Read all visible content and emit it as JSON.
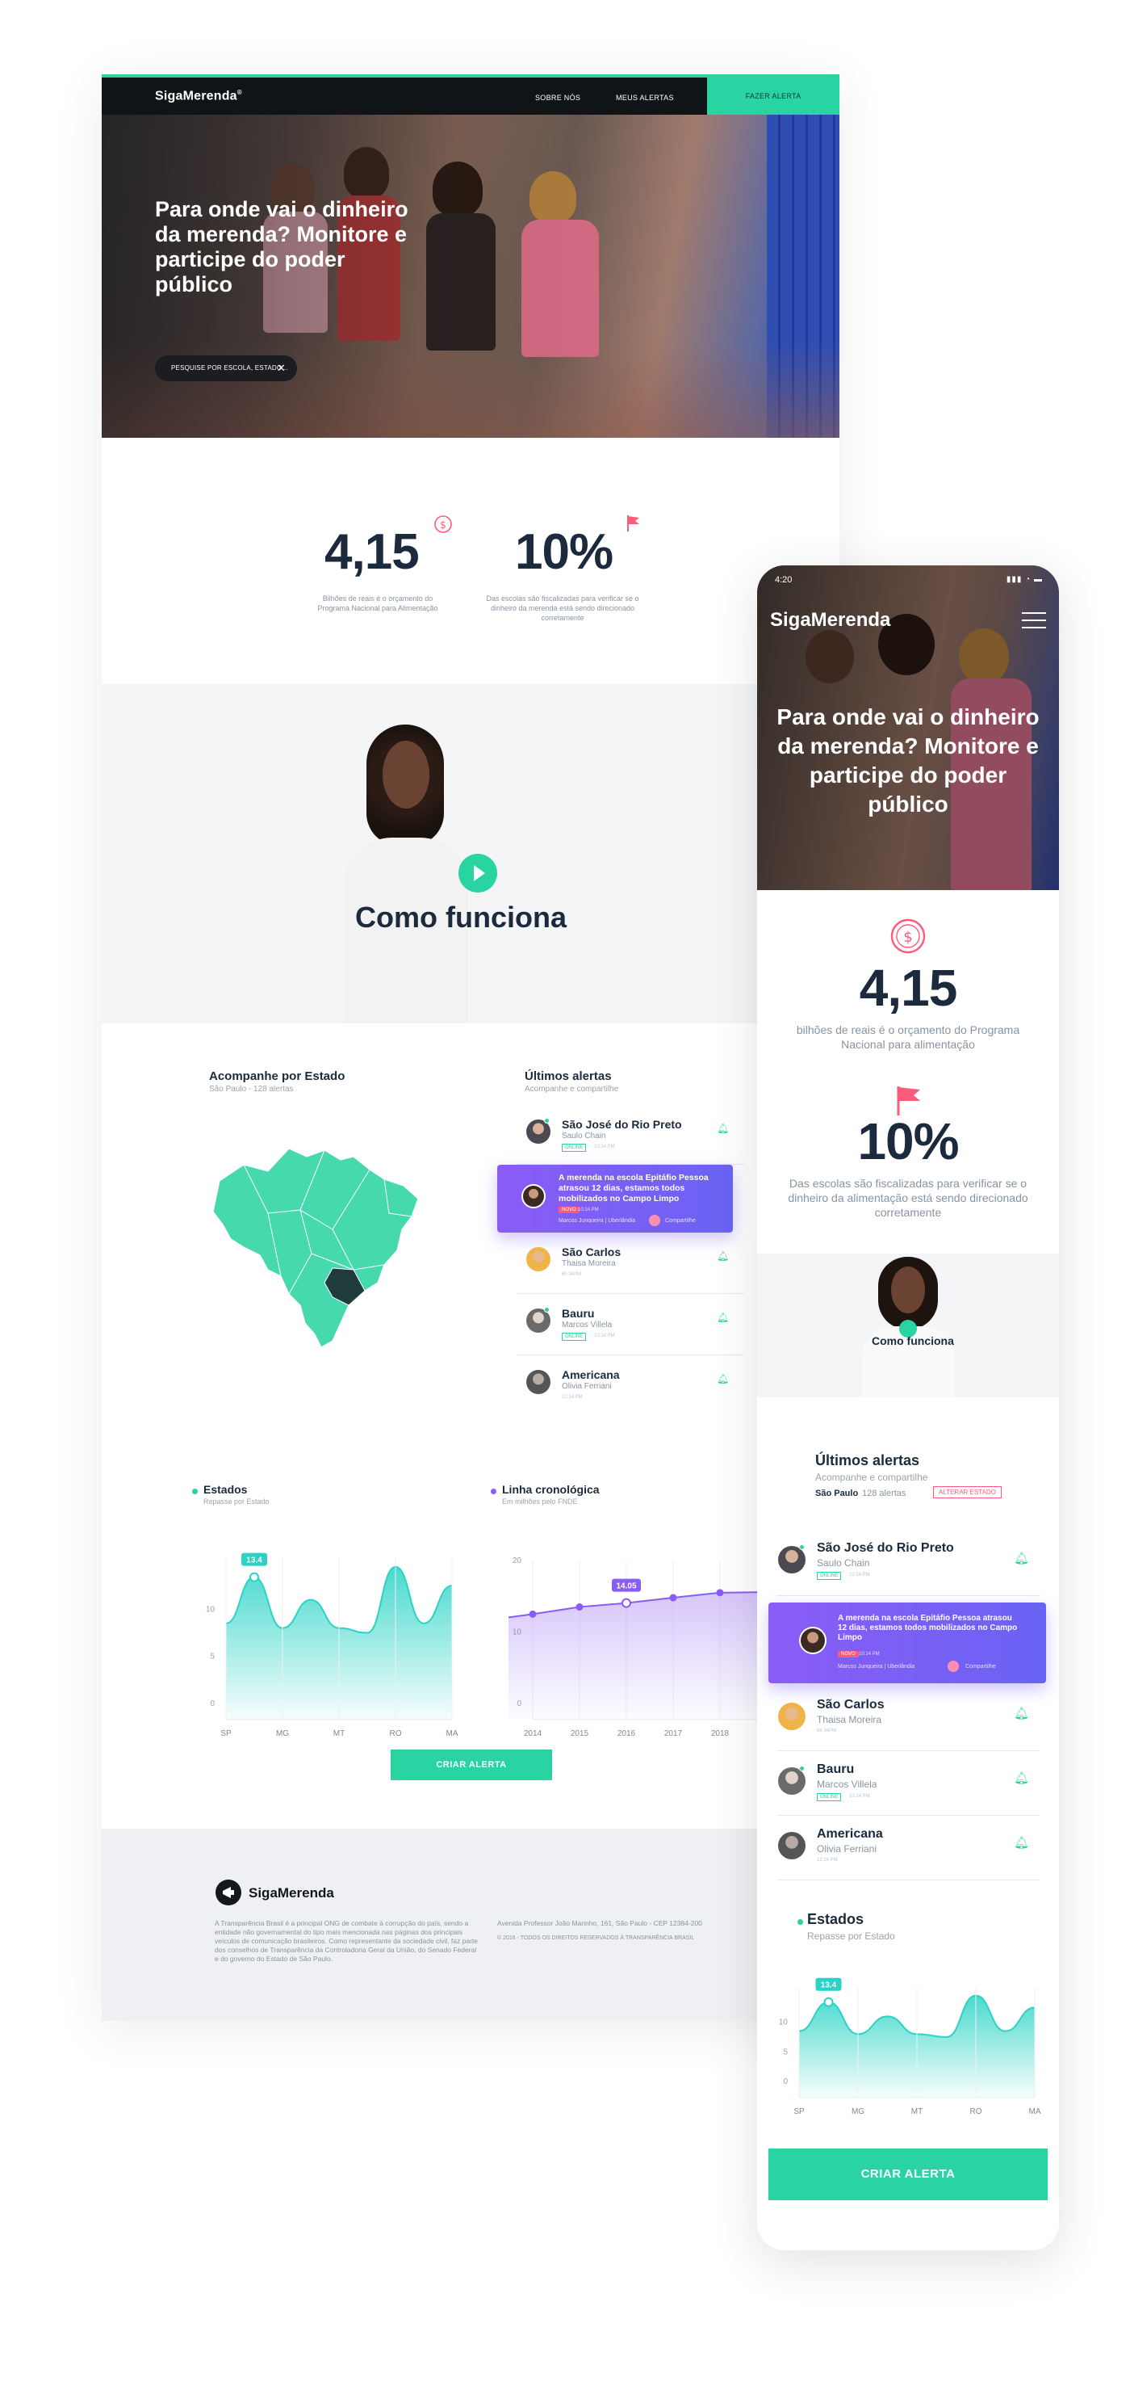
{
  "desktop": {
    "nav": {
      "logo": "SigaMerenda",
      "logo_mark": "®",
      "links": [
        "SOBRE NÓS",
        "MEUS ALERTAS"
      ],
      "cta": "FAZER ALERTA"
    },
    "hero": {
      "title": "Para onde vai o dinheiro da merenda? Monitore e participe do poder público",
      "search_placeholder": "PESQUISE POR ESCOLA, ESTADO...",
      "search_clear": "✕"
    },
    "stats": [
      {
        "value": "4,15",
        "icon": "dollar-coin-icon",
        "desc": "Bilhões de reais é o orçamento do Programa Nacional para Alimentação"
      },
      {
        "value": "10%",
        "icon": "flag-icon",
        "desc": "Das escolas são fiscalizadas para verificar se o dinheiro da merenda está sendo direcionado corretamente"
      }
    ],
    "video": {
      "title": "Como funciona"
    },
    "state_map": {
      "title": "Acompanhe por Estado",
      "subtitle": "São Paulo - 128 alertas"
    },
    "alerts": {
      "title": "Últimos alertas",
      "subtitle": "Acompanhe e compartilhe",
      "items": [
        {
          "name": "São José do Rio Preto",
          "user": "Saulo Chain",
          "badge": "ONLINE",
          "time": "10:14 PM"
        },
        {
          "highlight": true,
          "text": "A merenda na escola Epitáfio Pessoa atrasou 12 dias, estamos todos mobilizados no Campo Limpo",
          "tag": "NOVO",
          "time": "10:14 PM",
          "meta": "Marcos Junqueira | Uberlândia",
          "share": "Compartilhe"
        },
        {
          "name": "São Carlos",
          "user": "Thaisa Moreira",
          "badge": "",
          "time": "6h 34PM"
        },
        {
          "name": "Bauru",
          "user": "Marcos Villela",
          "badge": "ONLINE",
          "time": "10:14 PM"
        },
        {
          "name": "Americana",
          "user": "Olivia Ferriani",
          "badge": "",
          "time": "12:14 PM"
        }
      ]
    },
    "charts": {
      "estados": {
        "title": "Estados",
        "subtitle": "Repasse por Estado",
        "callout": "13.4"
      },
      "linha": {
        "title": "Linha cronológica",
        "subtitle": "Em milhões pelo FNDE",
        "callout": "14.05"
      }
    },
    "cta": "CRIAR ALERTA",
    "footer": {
      "logo": "SigaMerenda",
      "about": "A Transparência Brasil é a principal ONG de combate à corrupção do país, sendo a entidade não governamental do tipo mais mencionada nas páginas dos principais veículos de comunicação brasileiros. Como representante da sociedade civil, faz parte dos conselhos de Transparência da Controladoria Geral da União, do Senado Federal e do governo do Estado de São Paulo.",
      "address": "Avenida Professor João Marinho, 161, São Paulo - CEP 12384-200",
      "copyright": "© 2016 - TODOS OS DIREITOS RESERVADOS À TRANSPARÊNCIA BRASIL"
    }
  },
  "mobile": {
    "status_time": "4:20",
    "logo": "SigaMerenda",
    "hero_title": "Para onde vai o dinheiro da merenda? Monitore e participe do poder público",
    "stats": [
      {
        "value": "4,15",
        "desc": "bilhões de reais é o orçamento do Programa Nacional para alimentação"
      },
      {
        "value": "10%",
        "desc": "Das escolas são fiscalizadas para verificar se o dinheiro da alimentação está sendo direcionado corretamente"
      }
    ],
    "video_title": "Como funciona",
    "alerts": {
      "title": "Últimos alertas",
      "subtitle": "Acompanhe e compartilhe",
      "state": "São Paulo",
      "count": "128 alertas",
      "change": "ALTERAR ESTADO",
      "items": [
        {
          "name": "São José do Rio Preto",
          "user": "Saulo Chain",
          "badge": "ONLINE",
          "time": "10:14 PM"
        },
        {
          "highlight": true,
          "text": "A merenda na escola Epitáfio Pessoa atrasou 12 dias, estamos todos mobilizados no Campo Limpo",
          "tag": "NOVO",
          "time": "10:14 PM",
          "meta": "Marcos Junqueira | Uberlândia",
          "share": "Compartilhe"
        },
        {
          "name": "São Carlos",
          "user": "Thaisa Moreira",
          "badge": "",
          "time": "6h 34PM"
        },
        {
          "name": "Bauru",
          "user": "Marcos Villela",
          "badge": "ONLINE",
          "time": "10:14 PM"
        },
        {
          "name": "Americana",
          "user": "Olivia Ferriani",
          "badge": "",
          "time": "12:14 PM"
        }
      ]
    },
    "chart": {
      "title": "Estados",
      "subtitle": "Repasse por Estado",
      "callout": "13.4"
    },
    "cta": "CRIAR ALERTA"
  },
  "chart_data": [
    {
      "type": "area",
      "title": "Estados",
      "subtitle": "Repasse por Estado",
      "categories": [
        "SP",
        "MG",
        "MT",
        "RO",
        "MA"
      ],
      "y_ticks": [
        10,
        5,
        0
      ],
      "ylim": [
        0,
        15
      ],
      "x": [
        0,
        0.5,
        1,
        1.5,
        2,
        2.5,
        3,
        3.5,
        4
      ],
      "values": [
        8.5,
        13.4,
        8.0,
        11.0,
        8.0,
        7.5,
        14.5,
        8.5,
        12.5
      ],
      "callout": {
        "x": 0.5,
        "label": "13.4"
      }
    },
    {
      "type": "line",
      "title": "Linha cronológica",
      "subtitle": "Em milhões pelo FNDE",
      "categories": [
        "2014",
        "2015",
        "2016",
        "2017",
        "2018"
      ],
      "y_ticks": [
        20,
        10,
        0
      ],
      "ylim": [
        0,
        20
      ],
      "values": [
        12.5,
        13.5,
        14.05,
        14.8,
        15.5
      ],
      "callout": {
        "index": 2,
        "label": "14.05"
      }
    }
  ]
}
